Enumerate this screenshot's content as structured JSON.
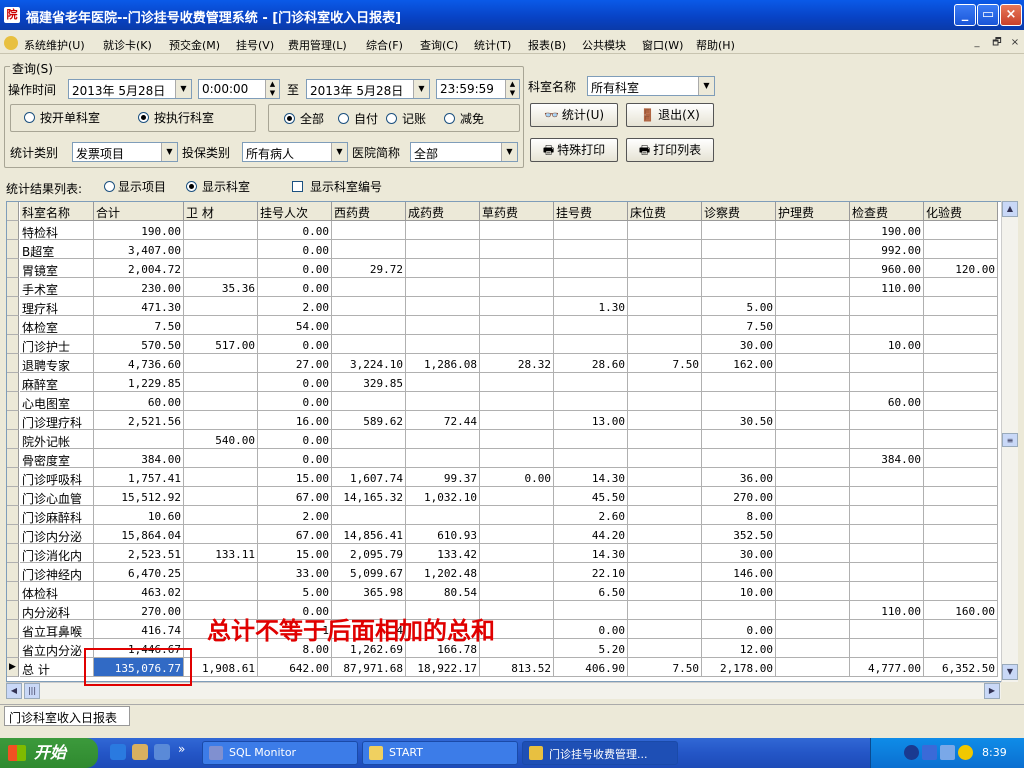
{
  "window": {
    "title": "福建省老年医院--门诊挂号收费管理系统 - [门诊科室收入日报表]",
    "icon": "hospital-icon"
  },
  "menu": {
    "items": [
      "系统维护(U)",
      "就诊卡(K)",
      "预交金(M)",
      "挂号(V)",
      "费用管理(L)",
      "综合(F)",
      "查询(C)",
      "统计(T)",
      "报表(B)",
      "公共模块",
      "窗口(W)",
      "帮助(H)"
    ],
    "mdi_controls": [
      "_",
      "🗗",
      "×"
    ]
  },
  "query": {
    "group_label": "查询(S)",
    "time_label": "操作时间",
    "start_date": "2013年 5月28日",
    "start_time": "0:00:00",
    "to_label": "至",
    "end_date": "2013年 5月28日",
    "end_time": "23:59:59",
    "dept_label": "科室名称",
    "dept_value": "所有科室",
    "radio_open": "按开单科室",
    "radio_exec": "按执行科室",
    "radio_all": "全部",
    "radio_self": "自付",
    "radio_account": "记账",
    "radio_reduce": "减免",
    "stat_button": "统计(U)",
    "exit_button": "退出(X)",
    "stat_type_label": "统计类别",
    "stat_type_value": "发票项目",
    "insure_label": "投保类别",
    "insure_value": "所有病人",
    "hospital_label": "医院简称",
    "hospital_value": "全部",
    "special_print_button": "特殊打印",
    "print_list_button": "打印列表"
  },
  "results": {
    "label": "统计结果列表:",
    "radio_item": "显示项目",
    "radio_dept": "显示科室",
    "chk_dept_code": "显示科室编号"
  },
  "table": {
    "columns": [
      "科室名称",
      "合计",
      "卫 材",
      "挂号人次",
      "西药费",
      "成药费",
      "草药费",
      "挂号费",
      "床位费",
      "诊察费",
      "护理费",
      "检查费",
      "化验费"
    ],
    "rows": [
      [
        "特检科",
        "190.00",
        "",
        "0.00",
        "",
        "",
        "",
        "",
        "",
        "",
        "",
        "190.00",
        ""
      ],
      [
        "B超室",
        "3,407.00",
        "",
        "0.00",
        "",
        "",
        "",
        "",
        "",
        "",
        "",
        "992.00",
        ""
      ],
      [
        "胃镜室",
        "2,004.72",
        "",
        "0.00",
        "29.72",
        "",
        "",
        "",
        "",
        "",
        "",
        "960.00",
        "120.00"
      ],
      [
        "手术室",
        "230.00",
        "35.36",
        "0.00",
        "",
        "",
        "",
        "",
        "",
        "",
        "",
        "110.00",
        ""
      ],
      [
        "理疗科",
        "471.30",
        "",
        "2.00",
        "",
        "",
        "",
        "1.30",
        "",
        "5.00",
        "",
        "",
        ""
      ],
      [
        "体检室",
        "7.50",
        "",
        "54.00",
        "",
        "",
        "",
        "",
        "",
        "7.50",
        "",
        "",
        ""
      ],
      [
        "门诊护士",
        "570.50",
        "517.00",
        "0.00",
        "",
        "",
        "",
        "",
        "",
        "30.00",
        "",
        "10.00",
        ""
      ],
      [
        "退聘专家",
        "4,736.60",
        "",
        "27.00",
        "3,224.10",
        "1,286.08",
        "28.32",
        "28.60",
        "7.50",
        "162.00",
        "",
        "",
        ""
      ],
      [
        "麻醉室",
        "1,229.85",
        "",
        "0.00",
        "329.85",
        "",
        "",
        "",
        "",
        "",
        "",
        "",
        ""
      ],
      [
        "心电图室",
        "60.00",
        "",
        "0.00",
        "",
        "",
        "",
        "",
        "",
        "",
        "",
        "60.00",
        ""
      ],
      [
        "门诊理疗科",
        "2,521.56",
        "",
        "16.00",
        "589.62",
        "72.44",
        "",
        "13.00",
        "",
        "30.50",
        "",
        "",
        ""
      ],
      [
        "院外记帐",
        "",
        "540.00",
        "0.00",
        "",
        "",
        "",
        "",
        "",
        "",
        "",
        "",
        ""
      ],
      [
        "骨密度室",
        "384.00",
        "",
        "0.00",
        "",
        "",
        "",
        "",
        "",
        "",
        "",
        "384.00",
        ""
      ],
      [
        "门诊呼吸科",
        "1,757.41",
        "",
        "15.00",
        "1,607.74",
        "99.37",
        "0.00",
        "14.30",
        "",
        "36.00",
        "",
        "",
        ""
      ],
      [
        "门诊心血管",
        "15,512.92",
        "",
        "67.00",
        "14,165.32",
        "1,032.10",
        "",
        "45.50",
        "",
        "270.00",
        "",
        "",
        ""
      ],
      [
        "门诊麻醉科",
        "10.60",
        "",
        "2.00",
        "",
        "",
        "",
        "2.60",
        "",
        "8.00",
        "",
        "",
        ""
      ],
      [
        "门诊内分泌",
        "15,864.04",
        "",
        "67.00",
        "14,856.41",
        "610.93",
        "",
        "44.20",
        "",
        "352.50",
        "",
        "",
        ""
      ],
      [
        "门诊消化内",
        "2,523.51",
        "133.11",
        "15.00",
        "2,095.79",
        "133.42",
        "",
        "14.30",
        "",
        "30.00",
        "",
        "",
        ""
      ],
      [
        "门诊神经内",
        "6,470.25",
        "",
        "33.00",
        "5,099.67",
        "1,202.48",
        "",
        "22.10",
        "",
        "146.00",
        "",
        "",
        ""
      ],
      [
        "体检科",
        "463.02",
        "",
        "5.00",
        "365.98",
        "80.54",
        "",
        "6.50",
        "",
        "10.00",
        "",
        "",
        ""
      ],
      [
        "内分泌科",
        "270.00",
        "",
        "0.00",
        "",
        "",
        "",
        "",
        "",
        "",
        "",
        "110.00",
        "160.00"
      ],
      [
        "省立耳鼻喉",
        "416.74",
        "",
        "1",
        "4",
        "",
        "",
        "0.00",
        "",
        "0.00",
        "",
        "",
        ""
      ],
      [
        "省立内分泌",
        "1,446.67",
        "",
        "8.00",
        "1,262.69",
        "166.78",
        "",
        "5.20",
        "",
        "12.00",
        "",
        "",
        ""
      ]
    ],
    "total_row": [
      "总 计",
      "135,076.77",
      "1,908.61",
      "642.00",
      "87,971.68",
      "18,922.17",
      "813.52",
      "406.90",
      "7.50",
      "2,178.00",
      "",
      "4,777.00",
      "6,352.50"
    ]
  },
  "annotation": "总计不等于后面相加的总和",
  "tab": "门诊科室收入日报表",
  "taskbar": {
    "start": "开始",
    "items": [
      "SQL Monitor",
      "START",
      "门诊挂号收费管理..."
    ],
    "clock": "8:39"
  },
  "colors": {
    "title_bar": "#0a5ae8",
    "annotation": "#e00000",
    "selection": "#316ac5",
    "taskbar": "#2456c7"
  }
}
